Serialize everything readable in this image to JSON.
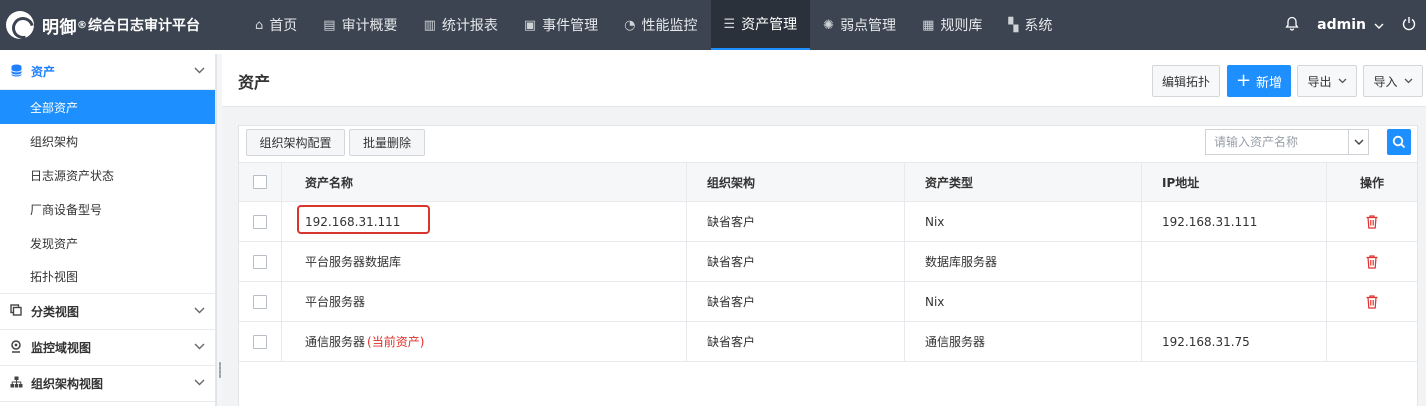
{
  "brand": {
    "name": "明御",
    "reg": "®",
    "subtitle": "综合日志审计平台"
  },
  "nav": [
    {
      "icon": "⌂",
      "label": "首页"
    },
    {
      "icon": "▤",
      "label": "审计概要"
    },
    {
      "icon": "▥",
      "label": "统计报表"
    },
    {
      "icon": "▣",
      "label": "事件管理"
    },
    {
      "icon": "◔",
      "label": "性能监控"
    },
    {
      "icon": "☰",
      "label": "资产管理"
    },
    {
      "icon": "✺",
      "label": "弱点管理"
    },
    {
      "icon": "▦",
      "label": "规则库"
    },
    {
      "icon": "▚",
      "label": "系统"
    }
  ],
  "user": {
    "name": "admin"
  },
  "sidebar": {
    "asset_group": "资产",
    "items": [
      "全部资产",
      "组织架构",
      "日志源资产状态",
      "厂商设备型号",
      "发现资产",
      "拓扑视图"
    ],
    "groups": [
      "分类视图",
      "监控域视图",
      "组织架构视图"
    ]
  },
  "page": {
    "title": "资产",
    "edit_topology": "编辑拓扑",
    "add": "新增",
    "export": "导出",
    "import": "导入"
  },
  "toolbar": {
    "org_config": "组织架构配置",
    "batch_delete": "批量删除",
    "search_placeholder": "请输入资产名称"
  },
  "table": {
    "headers": {
      "name": "资产名称",
      "org": "组织架构",
      "type": "资产类型",
      "ip": "IP地址",
      "ops": "操作"
    },
    "rows": [
      {
        "name": "192.168.31.111",
        "org": "缺省客户",
        "type": "Nix",
        "ip": "192.168.31.111",
        "current": ""
      },
      {
        "name": "平台服务器数据库",
        "org": "缺省客户",
        "type": "数据库服务器",
        "ip": "",
        "current": ""
      },
      {
        "name": "平台服务器",
        "org": "缺省客户",
        "type": "Nix",
        "ip": "",
        "current": ""
      },
      {
        "name": "通信服务器",
        "org": "缺省客户",
        "type": "通信服务器",
        "ip": "192.168.31.75",
        "current": "(当前资产)"
      }
    ]
  },
  "colors": {
    "accent": "#1e8fff",
    "topbar": "#3c4451",
    "danger": "#e0302a"
  }
}
